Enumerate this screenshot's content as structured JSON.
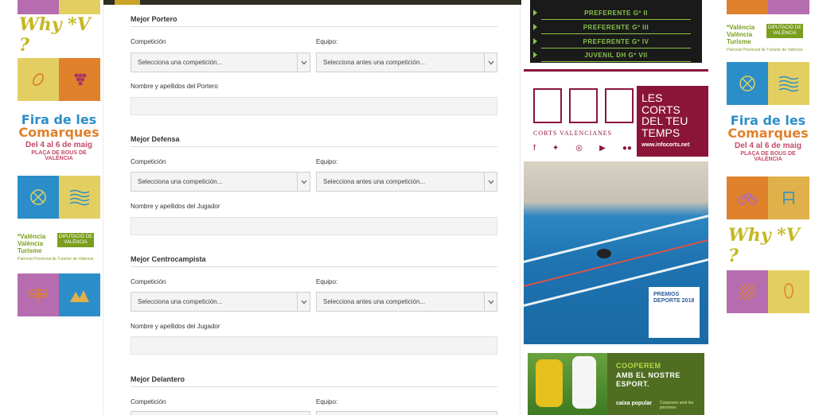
{
  "left_ads": {
    "why_v": "Why *V ?",
    "fira": {
      "line1": "Fira de les",
      "line2": "Comarques",
      "dates": "Del 4 al 6 de maig",
      "place": "PLAÇA DE BOUS DE VALÈNCIA"
    },
    "turisme": {
      "left": "*València València Turisme",
      "right": "DIPUTACIÓ DE VALÈNCIA",
      "sub": "Patronat Provincial de Turisme de València"
    }
  },
  "right_ads": {
    "fira": {
      "line1": "Fira de les",
      "line2": "Comarques",
      "dates": "Del 4 al 6 de maig",
      "place": "PLAÇA DE BOUS DE VALÈNCIA"
    },
    "turisme": {
      "left": "*València València Turisme",
      "right": "DIPUTACIÓ DE VALÈNCIA",
      "sub": "Patronat Provincial de Turisme de València"
    },
    "why_v": "Why *V ?"
  },
  "form": {
    "sections": [
      {
        "title": "Mejor Portero",
        "competition_label": "Competición",
        "team_label": "Equipo:",
        "competition_value": "Selecciona una competición...",
        "team_value": "Selecciona antes una competición...",
        "name_label": "Nombre y apellidos del Portero"
      },
      {
        "title": "Mejor Defensa",
        "competition_label": "Competición",
        "team_label": "Equipo:",
        "competition_value": "Selecciona una competición...",
        "team_value": "Selecciona antes una competición...",
        "name_label": "Nombre y apellidos del Jugador"
      },
      {
        "title": "Mejor Centrocampista",
        "competition_label": "Competición",
        "team_label": "Equipo:",
        "competition_value": "Selecciona una competición...",
        "team_value": "Selecciona antes una competición...",
        "name_label": "Nombre y apellidos del Jugador"
      },
      {
        "title": "Mejor Delantero",
        "competition_label": "Competición",
        "team_label": "Equipo:"
      }
    ]
  },
  "league_ad": {
    "rows": [
      "PREFERENTE Gº II",
      "PREFERENTE Gº III",
      "PREFERENTE Gº IV",
      "JUVENIL DH Gº VII"
    ]
  },
  "corts_ad": {
    "name": "CORTS VALENCIANES",
    "box_text": "LES CORTS DEL TEU TEMPS",
    "web": "www.infocorts.net"
  },
  "pool_ad": {
    "badge": "PREMIOS DEPORTE 2018"
  },
  "caixa_ad": {
    "line1": "COOPEREM",
    "line2": "AMB EL NOSTRE",
    "line3": "ESPORT.",
    "logo": "caixa popular",
    "tag": "Cooperem amb les persones"
  },
  "colors": {
    "accent": "#c9a227",
    "topbar": "#2f2c24",
    "corts": "#8b1538",
    "league_green": "#8bc34a"
  }
}
